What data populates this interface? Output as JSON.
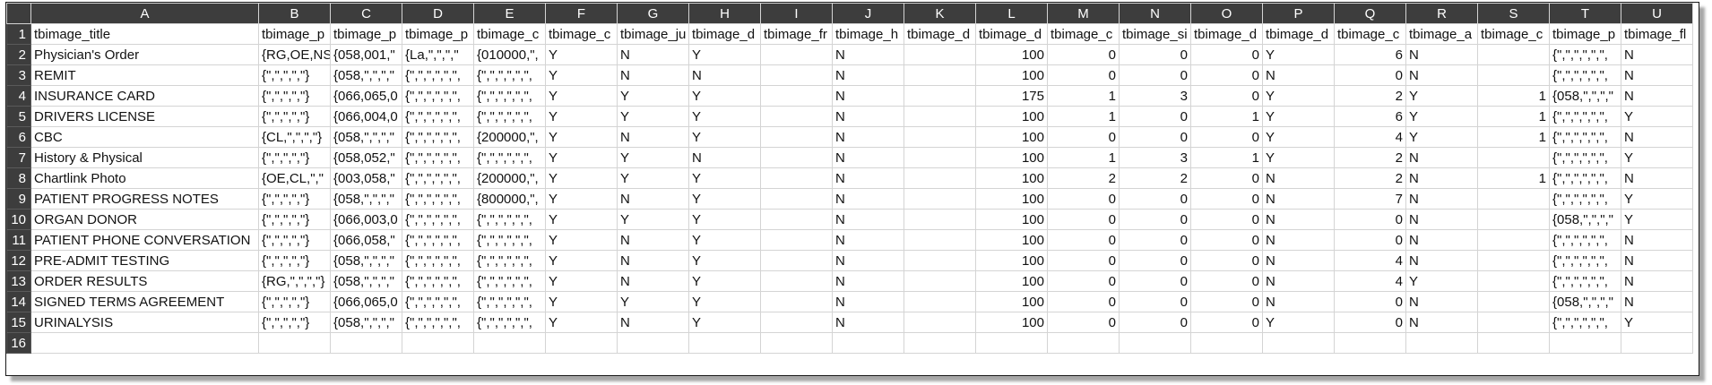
{
  "sheet": {
    "column_letters": [
      "A",
      "B",
      "C",
      "D",
      "E",
      "F",
      "G",
      "H",
      "I",
      "J",
      "K",
      "L",
      "M",
      "N",
      "O",
      "P",
      "Q",
      "R",
      "S",
      "T",
      "U"
    ],
    "numeric_columns": [
      11,
      12,
      13,
      14,
      16,
      18
    ],
    "header": [
      "tbimage_title",
      "tbimage_p",
      "tbimage_p",
      "tbimage_p",
      "tbimage_c",
      "tbimage_c",
      "tbimage_ju",
      "tbimage_d",
      "tbimage_fr",
      "tbimage_h",
      "tbimage_d",
      "tbimage_d",
      "tbimage_c",
      "tbimage_si",
      "tbimage_d",
      "tbimage_d",
      "tbimage_c",
      "tbimage_a",
      "tbimage_c",
      "tbimage_p",
      "tbimage_fl"
    ],
    "rows": [
      [
        "Physician's Order",
        "{RG,OE,NS",
        "{058,001,\"",
        "{La,\",\",\",\"",
        "{010000,\",",
        "Y",
        "N",
        "Y",
        "",
        "N",
        "",
        "100",
        "0",
        "0",
        "0",
        "Y",
        "6",
        "N",
        "",
        "{\",\",\",\",\",\",",
        "N"
      ],
      [
        "REMIT",
        "{\",\",\",\",\"}",
        "{058,\",\",\",\"",
        "{\",\",\",\",\",\",",
        "{\",\",\",\",\",\",",
        "Y",
        "N",
        "N",
        "",
        "N",
        "",
        "100",
        "0",
        "0",
        "0",
        "N",
        "0",
        "N",
        "",
        "{\",\",\",\",\",\",",
        "N"
      ],
      [
        "INSURANCE CARD",
        "{\",\",\",\",\"}",
        "{066,065,0",
        "{\",\",\",\",\",\",",
        "{\",\",\",\",\",\",",
        "Y",
        "Y",
        "Y",
        "",
        "N",
        "",
        "175",
        "1",
        "3",
        "0",
        "Y",
        "2",
        "Y",
        "1",
        "{058,\",\",\",\"",
        "N"
      ],
      [
        "DRIVERS LICENSE",
        "{\",\",\",\",\"}",
        "{066,004,0",
        "{\",\",\",\",\",\",",
        "{\",\",\",\",\",\",",
        "Y",
        "Y",
        "Y",
        "",
        "N",
        "",
        "100",
        "1",
        "0",
        "1",
        "Y",
        "6",
        "Y",
        "1",
        "{\",\",\",\",\",\",",
        "Y"
      ],
      [
        "CBC",
        "{CL,\",\",\",\"}",
        "{058,\",\",\",\"",
        "{\",\",\",\",\",\",",
        "{200000,\",",
        "Y",
        "N",
        "Y",
        "",
        "N",
        "",
        "100",
        "0",
        "0",
        "0",
        "Y",
        "4",
        "Y",
        "1",
        "{\",\",\",\",\",\",",
        "N"
      ],
      [
        "History & Physical",
        "{\",\",\",\",\"}",
        "{058,052,\"",
        "{\",\",\",\",\",\",",
        "{\",\",\",\",\",\",",
        "Y",
        "Y",
        "N",
        "",
        "N",
        "",
        "100",
        "1",
        "3",
        "1",
        "Y",
        "2",
        "N",
        "",
        "{\",\",\",\",\",\",",
        "Y"
      ],
      [
        "Chartlink Photo",
        "{OE,CL,\",\"",
        "{003,058,\"",
        "{\",\",\",\",\",\",",
        "{200000,\",",
        "Y",
        "Y",
        "Y",
        "",
        "N",
        "",
        "100",
        "2",
        "2",
        "0",
        "N",
        "2",
        "N",
        "1",
        "{\",\",\",\",\",\",",
        "N"
      ],
      [
        "PATIENT PROGRESS NOTES",
        "{\",\",\",\",\"}",
        "{058,\",\",\",\"",
        "{\",\",\",\",\",\",",
        "{800000,\",",
        "Y",
        "N",
        "Y",
        "",
        "N",
        "",
        "100",
        "0",
        "0",
        "0",
        "N",
        "7",
        "N",
        "",
        "{\",\",\",\",\",\",",
        "Y"
      ],
      [
        "ORGAN DONOR",
        "{\",\",\",\",\"}",
        "{066,003,0",
        "{\",\",\",\",\",\",",
        "{\",\",\",\",\",\",",
        "Y",
        "Y",
        "Y",
        "",
        "N",
        "",
        "100",
        "0",
        "0",
        "0",
        "N",
        "0",
        "N",
        "",
        "{058,\",\",\",\"",
        "Y"
      ],
      [
        "PATIENT PHONE CONVERSATION",
        "{\",\",\",\",\"}",
        "{066,058,\"",
        "{\",\",\",\",\",\",",
        "{\",\",\",\",\",\",",
        "Y",
        "N",
        "Y",
        "",
        "N",
        "",
        "100",
        "0",
        "0",
        "0",
        "N",
        "0",
        "N",
        "",
        "{\",\",\",\",\",\",",
        "N"
      ],
      [
        "PRE-ADMIT TESTING",
        "{\",\",\",\",\"}",
        "{058,\",\",\",\"",
        "{\",\",\",\",\",\",",
        "{\",\",\",\",\",\",",
        "Y",
        "N",
        "Y",
        "",
        "N",
        "",
        "100",
        "0",
        "0",
        "0",
        "N",
        "4",
        "N",
        "",
        "{\",\",\",\",\",\",",
        "N"
      ],
      [
        "ORDER RESULTS",
        "{RG,\",\",\",\"}",
        "{058,\",\",\",\"",
        "{\",\",\",\",\",\",",
        "{\",\",\",\",\",\",",
        "Y",
        "N",
        "Y",
        "",
        "N",
        "",
        "100",
        "0",
        "0",
        "0",
        "N",
        "4",
        "Y",
        "",
        "{\",\",\",\",\",\",",
        "N"
      ],
      [
        "SIGNED TERMS AGREEMENT",
        "{\",\",\",\",\"}",
        "{066,065,0",
        "{\",\",\",\",\",\",",
        "{\",\",\",\",\",\",",
        "Y",
        "Y",
        "Y",
        "",
        "N",
        "",
        "100",
        "0",
        "0",
        "0",
        "N",
        "0",
        "N",
        "",
        "{058,\",\",\",\"",
        "N"
      ],
      [
        "URINALYSIS",
        "{\",\",\",\",\"}",
        "{058,\",\",\",\"",
        "{\",\",\",\",\",\",",
        "{\",\",\",\",\",\",",
        "Y",
        "N",
        "Y",
        "",
        "N",
        "",
        "100",
        "0",
        "0",
        "0",
        "Y",
        "0",
        "N",
        "",
        "{\",\",\",\",\",\",",
        "Y"
      ],
      [
        "",
        "",
        "",
        "",
        "",
        "",
        "",
        "",
        "",
        "",
        "",
        "",
        "",
        "",
        "",
        "",
        "",
        "",
        "",
        "",
        ""
      ]
    ]
  },
  "colors": {
    "header_bg": "#3d3d3d",
    "header_fg": "#ffffff",
    "grid": "#d4d4d4"
  }
}
